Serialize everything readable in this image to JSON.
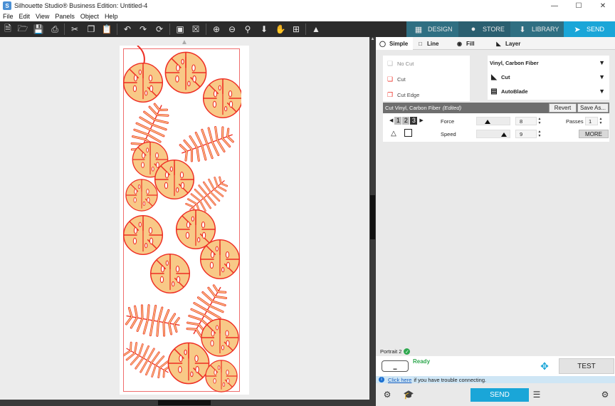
{
  "window": {
    "title": "Silhouette Studio® Business Edition: Untitled-4",
    "minimize": "—",
    "maximize": "☐",
    "close": "✕"
  },
  "menu": [
    "File",
    "Edit",
    "View",
    "Panels",
    "Object",
    "Help"
  ],
  "toolbar": {
    "icons": [
      "new-document-icon",
      "open-folder-icon",
      "save-icon",
      "print-icon",
      "cut-icon",
      "copy-icon",
      "paste-icon",
      "undo-icon",
      "redo-icon",
      "redraw-icon",
      "select-all-icon",
      "deselect-icon",
      "zoom-in-icon",
      "zoom-out-icon",
      "zoom-select-icon",
      "pan-down-icon",
      "hand-icon",
      "fit-page-icon",
      "trace-icon"
    ]
  },
  "nav_tabs": {
    "design": "DESIGN",
    "store": "STORE",
    "library": "LIBRARY",
    "send": "SEND"
  },
  "sub_tabs": {
    "simple": "Simple",
    "line": "Line",
    "fill": "Fill",
    "layer": "Layer"
  },
  "cut_options": {
    "no_cut": "No Cut",
    "cut": "Cut",
    "cut_edge": "Cut Edge"
  },
  "material": {
    "name": "Vinyl, Carbon Fiber",
    "action": "Cut",
    "tool": "AutoBlade"
  },
  "settings": {
    "header": "Cut Vinyl, Carbon Fiber",
    "edited": "(Edited)",
    "revert": "Revert",
    "save_as": "Save As...",
    "tool_numbers": [
      "1",
      "2",
      "3"
    ],
    "force_label": "Force",
    "force_value": "8",
    "force_level": 0.27,
    "speed_label": "Speed",
    "speed_value": "9",
    "speed_level": 0.85,
    "passes_label": "Passes",
    "passes_value": "1",
    "more": "MORE"
  },
  "device": {
    "name": "Portrait 2",
    "status": "Ready",
    "test": "TEST",
    "info_link": "Click here",
    "info_text": "if you have trouble connecting."
  },
  "bottom": {
    "send": "SEND"
  },
  "colors": {
    "toolbar_bg": "#2b2b2b",
    "send_accent": "#1aa6d8",
    "leaf_fill": "#f8c987",
    "leaf_stroke": "#ee2e24",
    "cut_border": "#ef6d6d",
    "ready_green": "#2fa84f"
  }
}
